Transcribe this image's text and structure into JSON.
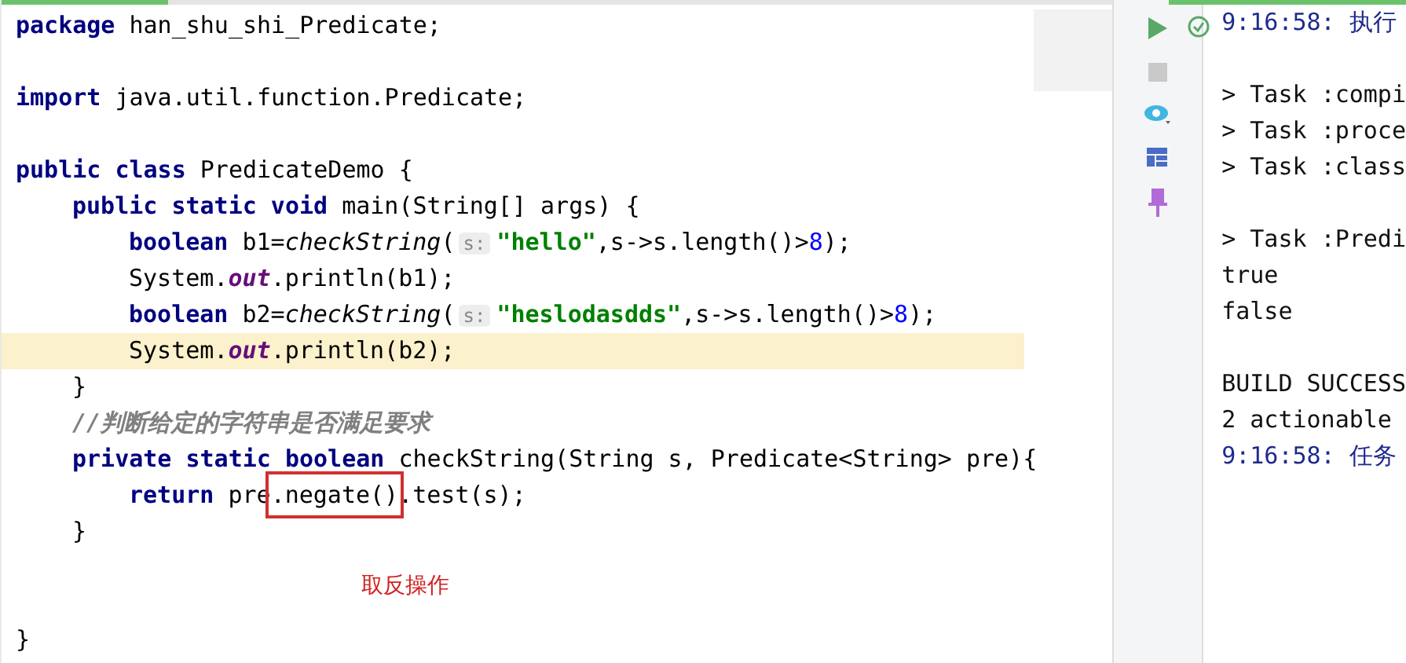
{
  "editor": {
    "progress": {
      "level": 0.15
    },
    "lines": [
      {
        "kind": "top",
        "current": false,
        "tokens": [
          {
            "kind": "kw",
            "text": "package"
          },
          {
            "kind": "plain",
            "text": " han_shu_shi_Predicate;"
          }
        ]
      },
      {
        "kind": "blank"
      },
      {
        "kind": "top",
        "current": false,
        "tokens": [
          {
            "kind": "kw",
            "text": "import"
          },
          {
            "kind": "plain",
            "text": " java.util.function.Predicate;"
          }
        ]
      },
      {
        "kind": "blank"
      },
      {
        "kind": "top",
        "current": false,
        "tokens": [
          {
            "kind": "kw",
            "text": "public class"
          },
          {
            "kind": "plain",
            "text": " PredicateDemo {"
          }
        ]
      },
      {
        "kind": "member",
        "current": false,
        "tokens": [
          {
            "kind": "kw",
            "text": "public static void"
          },
          {
            "kind": "plain",
            "text": " main(String[] args) {"
          }
        ]
      },
      {
        "kind": "body",
        "current": false,
        "tokens": [
          {
            "kind": "kw",
            "text": "boolean"
          },
          {
            "kind": "plain",
            "text": " b1="
          },
          {
            "kind": "call",
            "text": "checkString"
          },
          {
            "kind": "plain",
            "text": "("
          },
          {
            "kind": "hint",
            "text": "s:"
          },
          {
            "kind": "str",
            "text": "\"hello\""
          },
          {
            "kind": "plain",
            "text": ",s->s.length()>"
          },
          {
            "kind": "num",
            "text": "8"
          },
          {
            "kind": "plain",
            "text": ");"
          }
        ]
      },
      {
        "kind": "body",
        "current": false,
        "tokens": [
          {
            "kind": "plain",
            "text": "System."
          },
          {
            "kind": "field",
            "text": "out"
          },
          {
            "kind": "plain",
            "text": ".println(b1);"
          }
        ]
      },
      {
        "kind": "body",
        "current": false,
        "tokens": [
          {
            "kind": "kw",
            "text": "boolean"
          },
          {
            "kind": "plain",
            "text": " b2="
          },
          {
            "kind": "call",
            "text": "checkString"
          },
          {
            "kind": "plain",
            "text": "("
          },
          {
            "kind": "hint",
            "text": "s:"
          },
          {
            "kind": "str",
            "text": "\"heslodasdds\""
          },
          {
            "kind": "plain",
            "text": ",s->s.length()>"
          },
          {
            "kind": "num",
            "text": "8"
          },
          {
            "kind": "plain",
            "text": ");"
          }
        ]
      },
      {
        "kind": "body",
        "current": true,
        "tokens": [
          {
            "kind": "plain",
            "text": "System."
          },
          {
            "kind": "field",
            "text": "out"
          },
          {
            "kind": "plain",
            "text": ".println(b2);"
          }
        ]
      },
      {
        "kind": "member",
        "current": false,
        "tokens": [
          {
            "kind": "plain",
            "text": "}"
          }
        ]
      },
      {
        "kind": "member",
        "current": false,
        "tokens": [
          {
            "kind": "comment",
            "text": "//判断给定的字符串是否满足要求"
          }
        ]
      },
      {
        "kind": "member",
        "current": false,
        "tokens": [
          {
            "kind": "kw",
            "text": "private static boolean"
          },
          {
            "kind": "plain",
            "text": " checkString(String s, Predicate<String> pre){"
          }
        ]
      },
      {
        "kind": "body",
        "current": false,
        "tokens": [
          {
            "kind": "kw",
            "text": "return"
          },
          {
            "kind": "plain",
            "text": " pre"
          },
          {
            "kind": "boxed",
            "text": ".negate()"
          },
          {
            "kind": "plain",
            "text": ".test(s);"
          }
        ]
      },
      {
        "kind": "member",
        "current": false,
        "tokens": [
          {
            "kind": "plain",
            "text": "}"
          }
        ]
      },
      {
        "kind": "note",
        "text": "取反操作"
      },
      {
        "kind": "top",
        "current": false,
        "tokens": [
          {
            "kind": "plain",
            "text": "}"
          }
        ]
      }
    ]
  },
  "console": {
    "lines": [
      {
        "kind": "info",
        "text": "9:16:58: 执行"
      },
      {
        "kind": "blank"
      },
      {
        "kind": "plain",
        "text": "> Task :compi"
      },
      {
        "kind": "plain",
        "text": "> Task :proce"
      },
      {
        "kind": "plain",
        "text": "> Task :class"
      },
      {
        "kind": "blank"
      },
      {
        "kind": "plain",
        "text": "> Task :Predi"
      },
      {
        "kind": "plain",
        "text": "true"
      },
      {
        "kind": "plain",
        "text": "false"
      },
      {
        "kind": "blank"
      },
      {
        "kind": "plain",
        "text": "BUILD SUCCESS"
      },
      {
        "kind": "plain",
        "text": "2 actionable"
      },
      {
        "kind": "info",
        "text": "9:16:58: 任务"
      }
    ]
  }
}
